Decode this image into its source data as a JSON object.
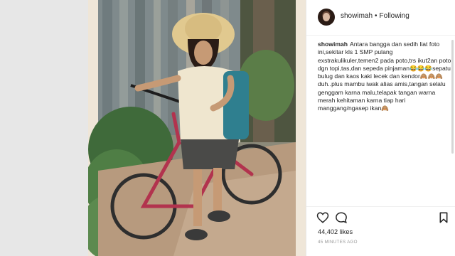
{
  "post": {
    "username": "showimah",
    "separator": "•",
    "follow_status": "Following",
    "caption_user": "showimah",
    "caption_text": "Antara bangga dan sedih liat foto ini,sekitar kls 1 SMP pulang exstrakulikuler,temen2 pada poto,trs ikut2an poto dgn topi,tas,dan sepeda pinjaman😂😂😂sepatu bulug dan kaos kaki lecek dan kendor🙈🙈🙈duh..plus mambu iwak alias amis,tangan selalu genggam karna malu,telapak tangan warna merah kehitaman karna tiap hari manggang/ngasep ikan🙈",
    "likes": "44,402 likes",
    "timestamp": "45 MINUTES AGO"
  },
  "icons": {
    "like": "heart-outline-icon",
    "comment": "speech-bubble-icon",
    "save": "bookmark-icon"
  },
  "colors": {
    "text": "#262626",
    "muted": "#999999",
    "border": "#efefef"
  }
}
